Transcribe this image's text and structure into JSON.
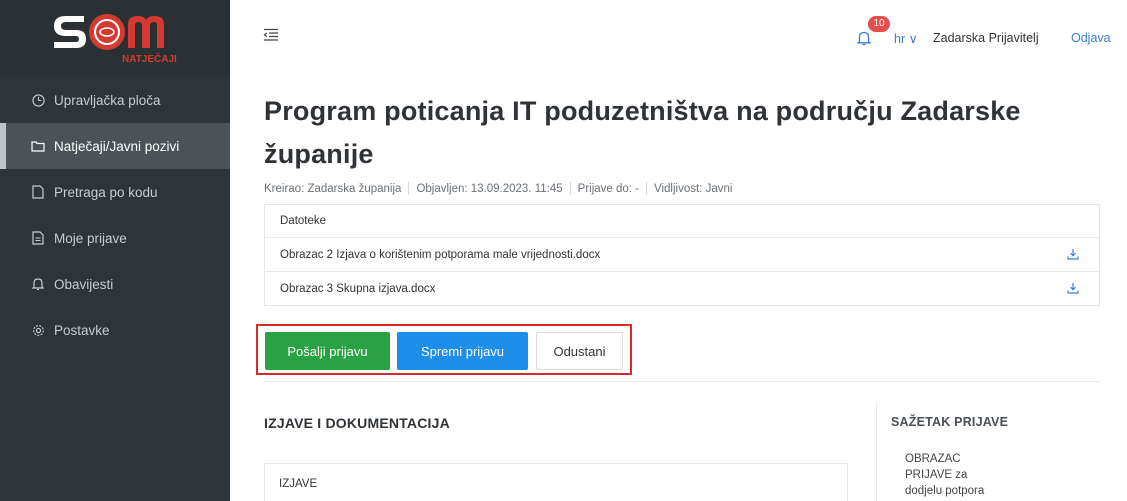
{
  "logo": {
    "main": "SOM",
    "sub": "NATJEČAJI"
  },
  "sidebar": {
    "items": [
      {
        "label": "Upravljačka ploča",
        "icon": "dashboard-icon"
      },
      {
        "label": "Natječaji/Javni pozivi",
        "icon": "folder-icon",
        "active": true
      },
      {
        "label": "Pretraga po kodu",
        "icon": "file-icon"
      },
      {
        "label": "Moje prijave",
        "icon": "document-icon"
      },
      {
        "label": "Obavijesti",
        "icon": "bell-icon"
      },
      {
        "label": "Postavke",
        "icon": "gear-icon"
      }
    ]
  },
  "header": {
    "notifications_count": "10",
    "language": "hr ∨",
    "user": "Zadarska Prijavitelj",
    "logout": "Odjava"
  },
  "page": {
    "title": "Program poticanja IT poduzetništva na području Zadarske županije",
    "meta": {
      "author": "Kreirao: Zadarska županija",
      "published": "Objavljen: 13.09.2023. 11:45",
      "deadline": "Prijave do: -",
      "visibility": "Vidljivost: Javni"
    },
    "files": {
      "header": "Datoteke",
      "items": [
        "Obrazac 2 Izjava o korištenim potporama male vrijednosti.docx",
        "Obrazac 3 Skupna izjava.docx"
      ]
    },
    "actions": {
      "send": "Pošalji prijavu",
      "save": "Spremi prijavu",
      "cancel": "Odustani"
    },
    "section_title": "IZJAVE I DOKUMENTACIJA",
    "izjave_label": "IZJAVE",
    "summary": {
      "title": "SAŽETAK PRIJAVE",
      "text": "OBRAZAC PRIJAVE za dodjelu potpora"
    }
  },
  "colors": {
    "sidebar": "#2e3439",
    "active_item": "#4b5359",
    "send_button": "#28a243",
    "save_button": "#1e8ee8",
    "highlight": "#d52b2b",
    "link": "#3d7be0",
    "badge": "#e74c4c"
  }
}
